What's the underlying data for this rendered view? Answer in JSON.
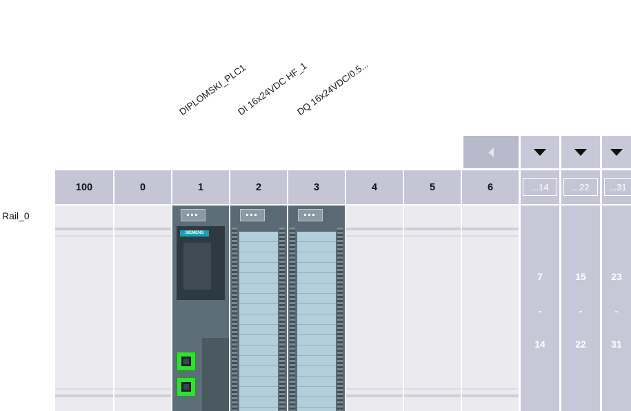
{
  "devices": [
    {
      "label": "DIPLOMSKI_PLC1"
    },
    {
      "label": "DI 16x24VDC HF_1"
    },
    {
      "label": "DQ 16x24VDC/0.5..."
    }
  ],
  "rail": {
    "label": "Rail_0"
  },
  "slots": [
    "100",
    "0",
    "1",
    "2",
    "3",
    "4",
    "5",
    "6"
  ],
  "expansion": [
    {
      "header": "...14",
      "from": "7",
      "dash": "-",
      "to": "14"
    },
    {
      "header": "...22",
      "from": "15",
      "dash": "-",
      "to": "22"
    },
    {
      "header": "...31",
      "from": "23",
      "dash": "-",
      "to": "31"
    }
  ],
  "cpu": {
    "brand": "SIEMENS"
  },
  "icons": {
    "scroll_left": "triangle-left-icon",
    "expand": "triangle-down-icon",
    "port": "ethernet-port-icon"
  },
  "colors": {
    "header": "#c5c5d6",
    "slot": "#ebebef",
    "module": "#5e6e78",
    "io_panel": "#b3cfdc",
    "port": "#33dd33"
  }
}
